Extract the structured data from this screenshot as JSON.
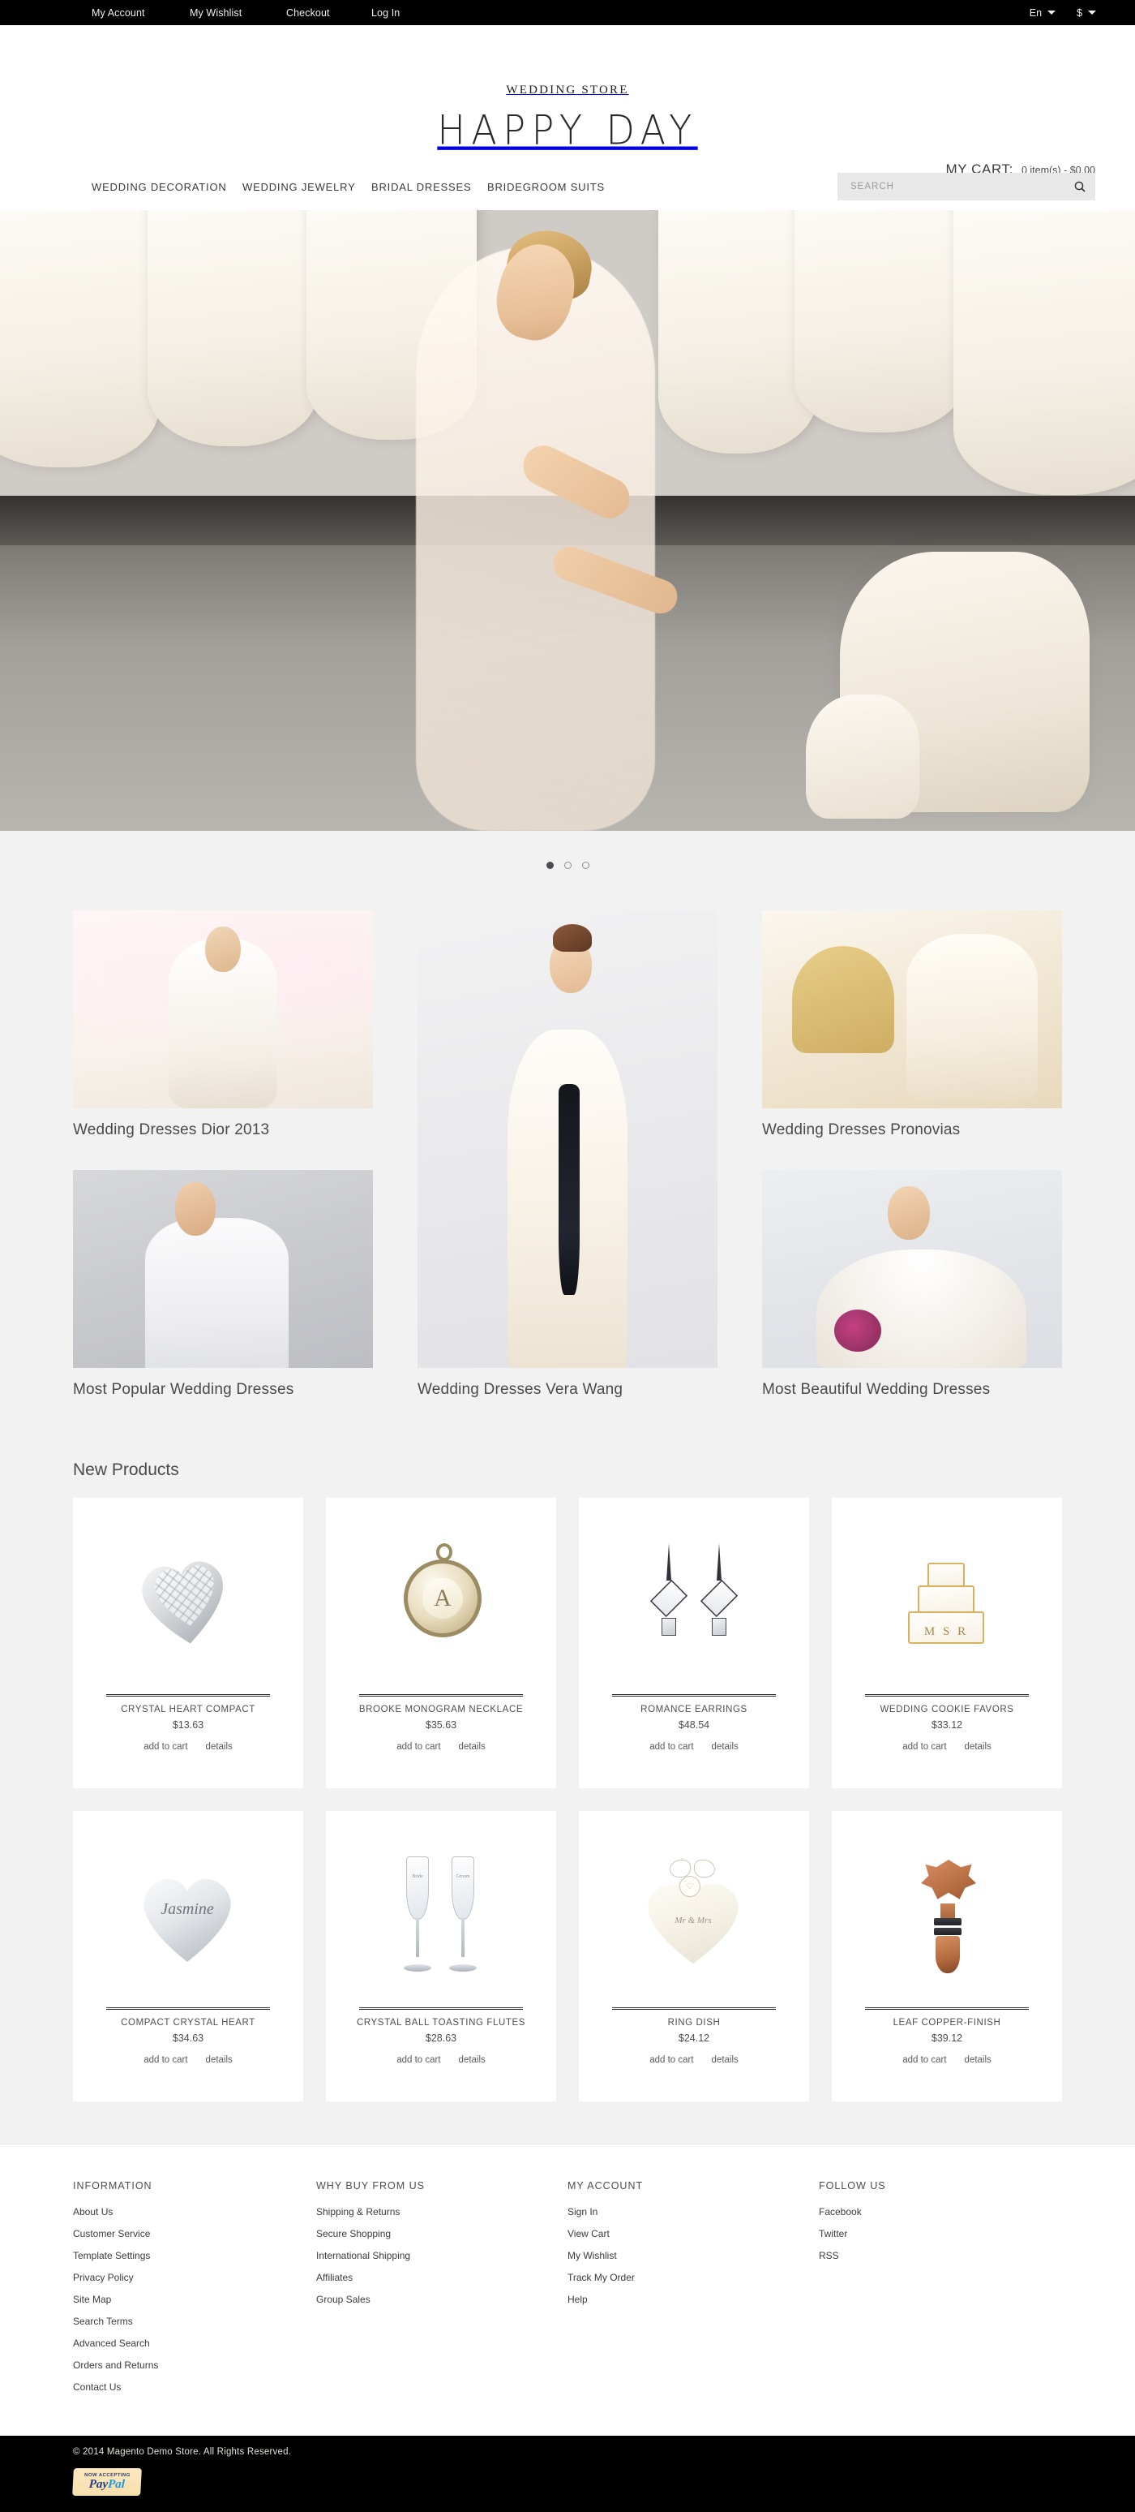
{
  "topbar": {
    "links": [
      {
        "label": "My Account"
      },
      {
        "label": "My Wishlist"
      },
      {
        "label": "Checkout"
      },
      {
        "label": "Log In"
      }
    ],
    "language": {
      "label": "En",
      "icon": "chevron-down-icon"
    },
    "currency": {
      "label": "$",
      "icon": "chevron-down-icon"
    }
  },
  "header": {
    "logo_top": "WEDDING STORE",
    "logo_main": "HAPPY DAY",
    "cart": {
      "label": "MY CART:",
      "value": "0 item(s) - $0.00"
    },
    "nav": [
      {
        "label": "WEDDING DECORATION"
      },
      {
        "label": "WEDDING JEWELRY"
      },
      {
        "label": "BRIDAL DRESSES"
      },
      {
        "label": "BRIDEGROOM SUITS"
      }
    ],
    "search": {
      "placeholder": "SEARCH",
      "value": "",
      "icon": "search-icon"
    }
  },
  "hero": {
    "alt": "Bride in veil seated in a bridal salon surrounded by wedding gowns and shoes",
    "dots": [
      {
        "active": true
      },
      {
        "active": false
      },
      {
        "active": false
      }
    ]
  },
  "categories": [
    {
      "title": "Wedding Dresses Dior 2013",
      "art": "room"
    },
    {
      "title": "Wedding Dresses Vera Wang",
      "art": "studio"
    },
    {
      "title": "Wedding Dresses Pronovias",
      "art": "gold"
    },
    {
      "title": "Most Popular Wedding Dresses",
      "art": "veilbride"
    },
    {
      "title": "Most Beautiful Wedding Dresses",
      "art": "tulle"
    }
  ],
  "new_products": {
    "title": "New Products",
    "add_to_cart_label": "add to cart",
    "details_label": "details",
    "items": [
      {
        "name": "CRYSTAL HEART COMPACT",
        "price": "$13.63",
        "art": "heart-compact"
      },
      {
        "name": "BROOKE MONOGRAM NECKLACE",
        "price": "$35.63",
        "art": "medallion"
      },
      {
        "name": "ROMANCE EARRINGS",
        "price": "$48.54",
        "art": "earrings"
      },
      {
        "name": "WEDDING COOKIE FAVORS",
        "price": "$33.12",
        "art": "cookie"
      },
      {
        "name": "COMPACT CRYSTAL HEART",
        "price": "$34.63",
        "art": "jasmine"
      },
      {
        "name": "CRYSTAL BALL TOASTING FLUTES",
        "price": "$28.63",
        "art": "flutes"
      },
      {
        "name": "RING DISH",
        "price": "$24.12",
        "art": "ringdish"
      },
      {
        "name": "LEAF COPPER-FINISH",
        "price": "$39.12",
        "art": "stopper"
      }
    ]
  },
  "product_art_text": {
    "medallion_mono": "A",
    "cookie_mono": "M S R",
    "jasmine_text": "Jasmine",
    "ringdish_text": "Mr & Mrs",
    "ringdish_tag": "♡",
    "flute_label_a": "Bride",
    "flute_label_b": "Groom"
  },
  "footer": {
    "columns": [
      {
        "heading": "INFORMATION",
        "links": [
          {
            "label": "About Us"
          },
          {
            "label": "Customer Service"
          },
          {
            "label": "Template Settings"
          },
          {
            "label": "Privacy Policy"
          },
          {
            "label": "Site Map"
          },
          {
            "label": "Search Terms"
          },
          {
            "label": "Advanced Search"
          },
          {
            "label": "Orders and Returns"
          },
          {
            "label": "Contact Us"
          }
        ]
      },
      {
        "heading": "WHY BUY FROM US",
        "links": [
          {
            "label": "Shipping & Returns"
          },
          {
            "label": "Secure Shopping"
          },
          {
            "label": "International Shipping"
          },
          {
            "label": "Affiliates"
          },
          {
            "label": "Group Sales"
          }
        ]
      },
      {
        "heading": "MY ACCOUNT",
        "links": [
          {
            "label": "Sign In"
          },
          {
            "label": "View Cart"
          },
          {
            "label": "My Wishlist"
          },
          {
            "label": "Track My Order"
          },
          {
            "label": "Help"
          }
        ]
      },
      {
        "heading": "FOLLOW US",
        "links": [
          {
            "label": "Facebook"
          },
          {
            "label": "Twitter"
          },
          {
            "label": "RSS"
          }
        ]
      }
    ],
    "copyright": "© 2014 Magento Demo Store. All Rights Reserved.",
    "paypal": {
      "now_accepting": "NOW ACCEPTING",
      "pay": "Pay",
      "pal": "Pal"
    }
  },
  "colors": {
    "topbar_bg": "#000000",
    "page_bg": "#f2f2f2",
    "card_bg": "#ffffff",
    "text": "#4a4a4a",
    "search_bg": "#e8e8e8"
  }
}
